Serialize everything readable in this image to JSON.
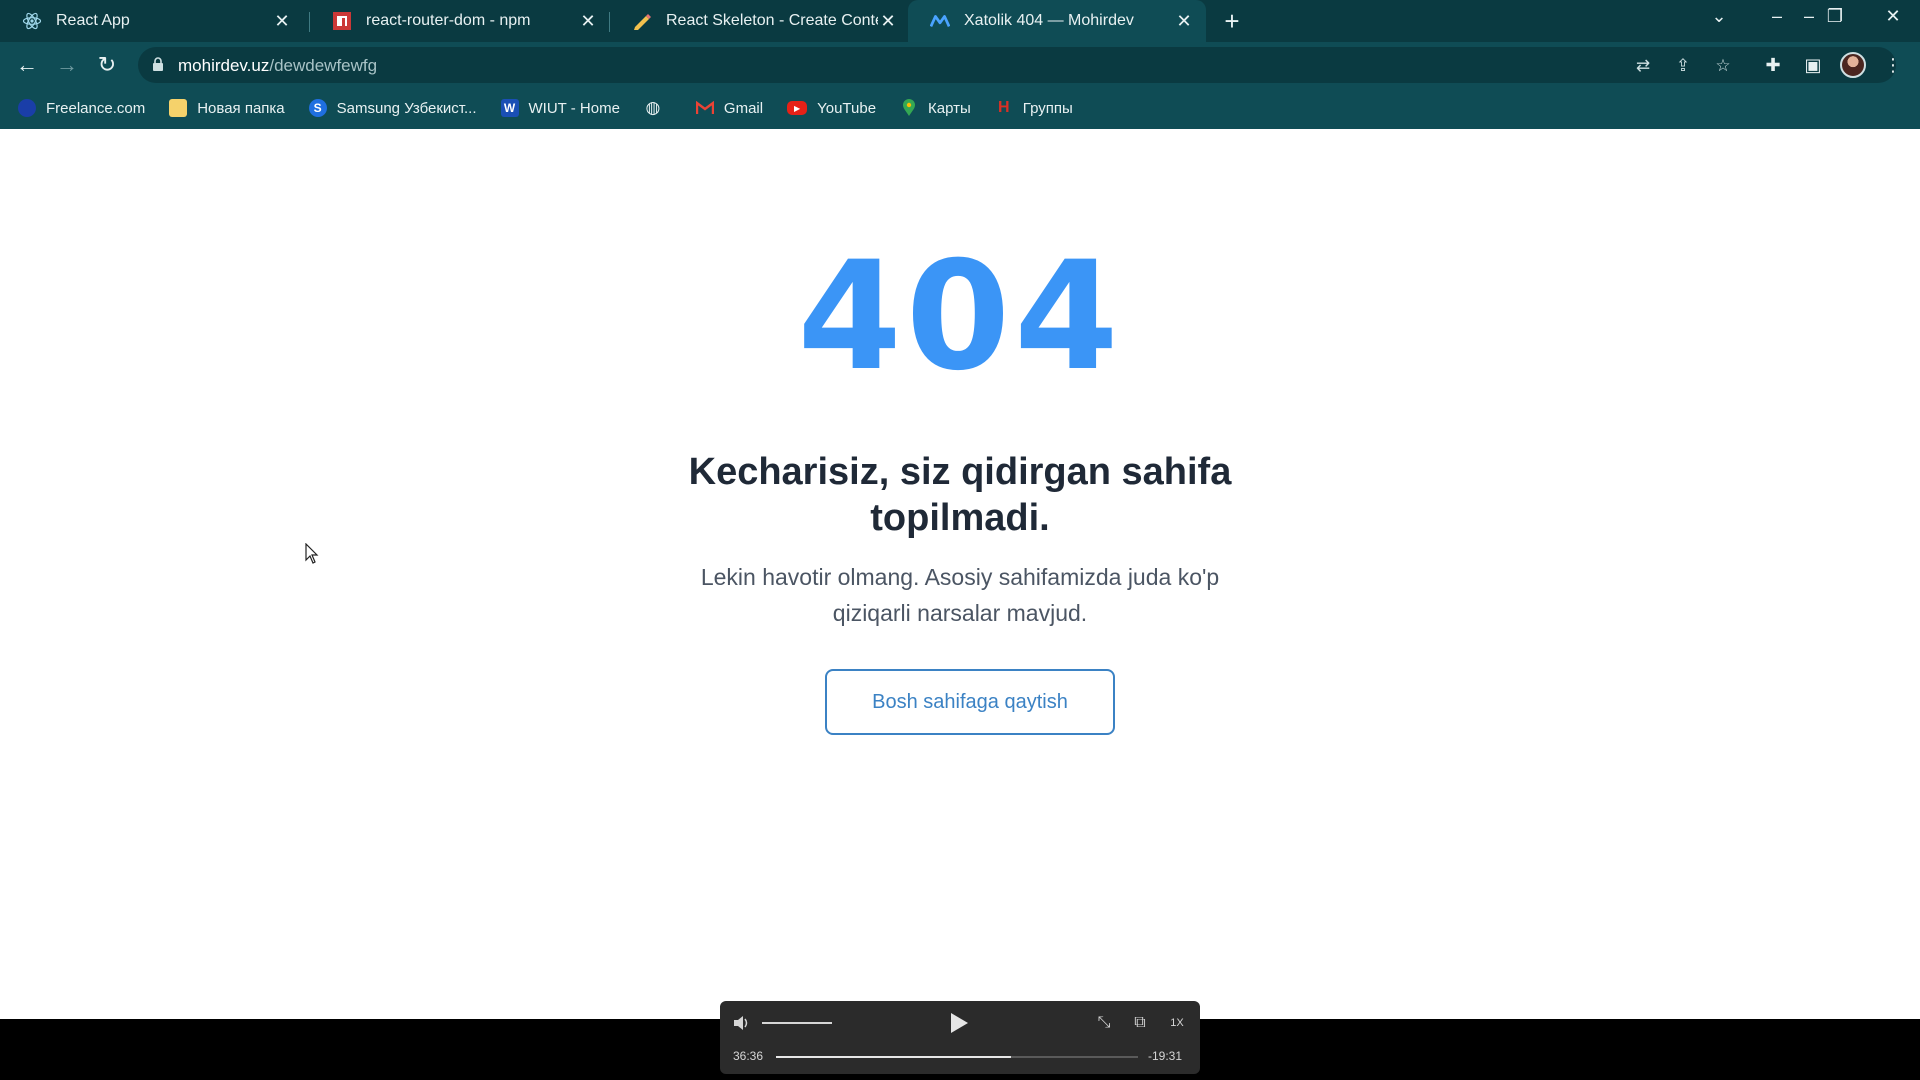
{
  "tabs": [
    {
      "title": "React App",
      "favicon": "react-icon"
    },
    {
      "title": "react-router-dom - npm",
      "favicon": "npm-icon"
    },
    {
      "title": "React Skeleton - Create Content Loader",
      "favicon": "pencil-icon"
    },
    {
      "title": "Xatolik 404 — Mohirdev",
      "favicon": "mohirdev-icon"
    }
  ],
  "address": {
    "domain": "mohirdev.uz",
    "path": "/dewdewfewfg"
  },
  "bookmarks": [
    {
      "label": "Freelance.com",
      "icon": "freelance-icon",
      "color": "#1a3ea8",
      "glyph": "●"
    },
    {
      "label": "Новая папка",
      "icon": "folder-icon",
      "color": "#f5d26b",
      "glyph": ""
    },
    {
      "label": "Samsung Узбекист...",
      "icon": "samsung-icon",
      "color": "#1f6fe0",
      "glyph": "S"
    },
    {
      "label": "WIUT - Home",
      "icon": "wiut-icon",
      "color": "#1a4fb5",
      "glyph": "W"
    },
    {
      "label": "",
      "icon": "globe-icon",
      "color": "#0f4c55",
      "glyph": "◍"
    },
    {
      "label": "Gmail",
      "icon": "gmail-icon",
      "color": "#ffffff",
      "glyph": "M"
    },
    {
      "label": "YouTube",
      "icon": "youtube-icon",
      "color": "#e62117",
      "glyph": "▶"
    },
    {
      "label": "Карты",
      "icon": "maps-icon",
      "color": "#34a853",
      "glyph": "⬤"
    },
    {
      "label": "Группы",
      "icon": "groups-icon",
      "color": "#d93025",
      "glyph": "H"
    }
  ],
  "page": {
    "code": "404",
    "headline": "Kecharisiz, siz qidirgan sahifa topilmadi.",
    "subtext": "Lekin havotir olmang. Asosiy sahifamizda juda ko'p qiziqarli narsalar mavjud.",
    "button": "Bosh sahifaga qaytish"
  },
  "player": {
    "elapsed": "36:36",
    "remaining": "-19:31",
    "progress": 0.65,
    "speed": "1X"
  },
  "colors": {
    "accent": "#3b95f6",
    "chrome": "#0f4c55",
    "button": "#3b82c4"
  }
}
